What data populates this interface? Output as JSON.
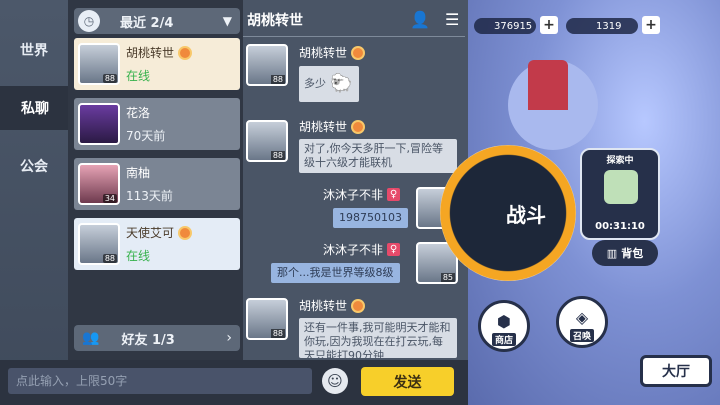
{
  "tabs": [
    {
      "label": "世界",
      "active": false
    },
    {
      "label": "私聊",
      "active": true
    },
    {
      "label": "公会",
      "active": false
    }
  ],
  "recent": {
    "label": "最近",
    "count": "2/4"
  },
  "friends_footer": {
    "label": "好友",
    "count": "1/3"
  },
  "friends": [
    {
      "name": "胡桃转世",
      "status": "在线",
      "level": "88",
      "state": "selected",
      "badge": true
    },
    {
      "name": "花洛",
      "status": "70天前",
      "level": "",
      "state": "offline",
      "badge": false
    },
    {
      "name": "南柚",
      "status": "113天前",
      "level": "34",
      "state": "offline",
      "badge": false
    },
    {
      "name": "天使艾可",
      "status": "在线",
      "level": "88",
      "state": "online",
      "badge": true
    }
  ],
  "chat": {
    "title": "胡桃转世",
    "messages": [
      {
        "side": "left",
        "sender": "胡桃转世",
        "text": "多少"
      },
      {
        "side": "left",
        "sender": "胡桃转世",
        "text": "对了,你今天多肝一下,冒险等级十六级才能联机"
      },
      {
        "side": "right",
        "sender": "沐沐子不非",
        "text": "198750103"
      },
      {
        "side": "right",
        "sender": "沐沐子不非",
        "text": "那个...我是世界等级8级"
      },
      {
        "side": "left",
        "sender": "胡桃转世",
        "text": "还有一件事,我可能明天才能和你玩,因为我现在在打云玩,每天只能打90分钟"
      }
    ],
    "self_level": "85",
    "friend_level": "88"
  },
  "input": {
    "placeholder": "点此输入，上限50字"
  },
  "send_label": "发送",
  "game": {
    "currency1": "376915",
    "currency2": "1319",
    "battle_label": "战斗",
    "explore_label": "探索中",
    "explore_time": "00:31:10",
    "bag_label": "背包",
    "shop_label": "商店",
    "summon_label": "召唤",
    "lobby_label": "大厅"
  },
  "colors": {
    "accent_yellow": "#f7cf2a",
    "online_green": "#37b24d",
    "panel_dark": "#303744"
  }
}
